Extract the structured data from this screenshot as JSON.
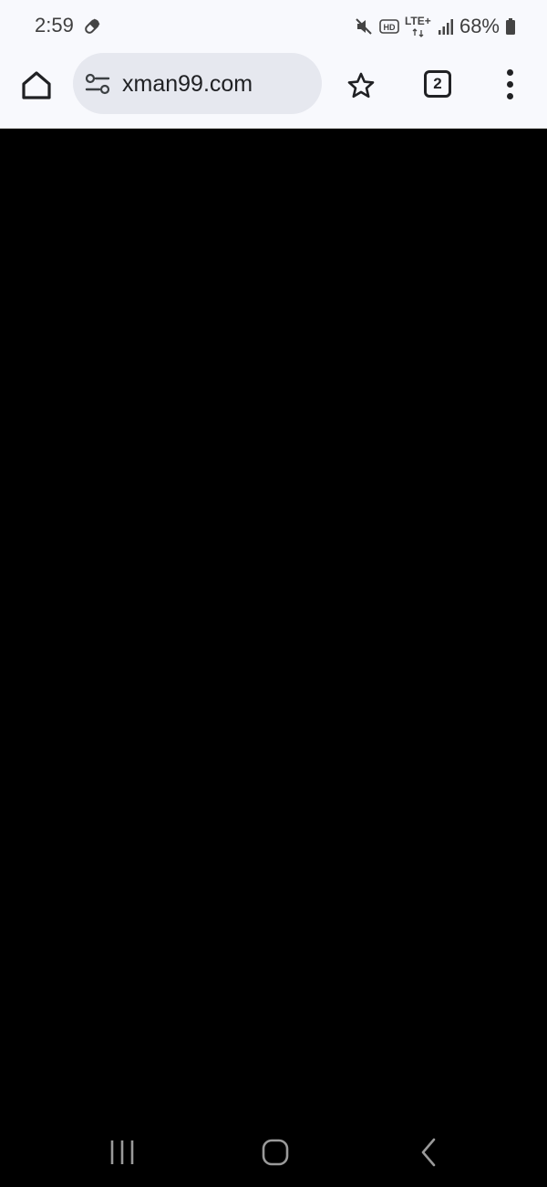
{
  "status_bar": {
    "time": "2:59",
    "network_label": "LTE+",
    "battery_percent": "68%",
    "icons": [
      "pill-icon",
      "mute-icon",
      "hd-icon",
      "lte-plus-icon",
      "signal-icon",
      "battery-icon"
    ]
  },
  "browser": {
    "url": "xman99.com",
    "tab_count": "2",
    "icons": [
      "home-icon",
      "site-settings-icon",
      "bookmark-star-icon",
      "tab-switcher-icon",
      "more-options-icon"
    ]
  },
  "nav_bar": {
    "icons": [
      "recents-icon",
      "home-icon",
      "back-icon"
    ]
  },
  "colors": {
    "toolbar_bg": "#f8f9fd",
    "omnibox_bg": "#e6e8ef",
    "page_bg": "#000000",
    "nav_icon": "#9a9a9a"
  }
}
